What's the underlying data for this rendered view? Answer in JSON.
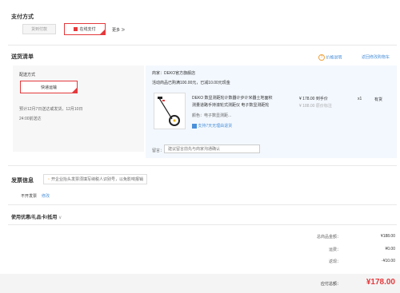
{
  "payment": {
    "title": "支付方式",
    "option_cod": "货到付款",
    "option_online": "在线支付",
    "more": "更多"
  },
  "shipping": {
    "title": "送货清单",
    "price_note": "价格说明",
    "back_to_cart": "返回修改购物车",
    "method_label": "配送方式",
    "method_value": "快递运输",
    "estimate_line1": "预计12月7日送达或发货，12月10日",
    "estimate_line2": "24:00前送达"
  },
  "store": {
    "seller_prefix": "商家：",
    "seller_name": "DEKO官方旗舰店",
    "promo": "活动商品已购满100.00元，已减10.00元现金"
  },
  "product": {
    "title_line1": "DEKO 数显测距轮计数器计步计米器土地面积",
    "title_line2": "测量道路手持滚轮式测距仪 电子数显测距轮",
    "color": "颜色：电子数显测距...",
    "return_policy": "支持7天无理由退货",
    "price": "¥ 178.00",
    "price_tag": "到手价",
    "original_price": "¥ 188.00",
    "original_tag": "原价标注",
    "quantity": "x1",
    "stock": "有货"
  },
  "remark": {
    "label": "留言：",
    "placeholder": "建议留言前先与商家沟通确认"
  },
  "invoice": {
    "title": "发票信息",
    "tip": "开企业抬头发票须填写纳税人识别号，以免影响报销",
    "value": "不开发票",
    "edit": "修改"
  },
  "coupon": {
    "title": "使用优惠/礼品卡/抵用"
  },
  "summary": {
    "total_label": "总商品金额：",
    "total_value": "¥188.00",
    "shipping_label": "运费：",
    "shipping_value": "¥0.00",
    "discount_label": "返现：",
    "discount_value": "-¥10.00",
    "payable_label": "应付总额：",
    "payable_value": "¥178.00"
  },
  "colors": {
    "accent_red": "#e4393c",
    "link_blue": "#4a90d9",
    "panel_blue": "#f3f8fe",
    "panel_gray": "#f7f7f7"
  }
}
